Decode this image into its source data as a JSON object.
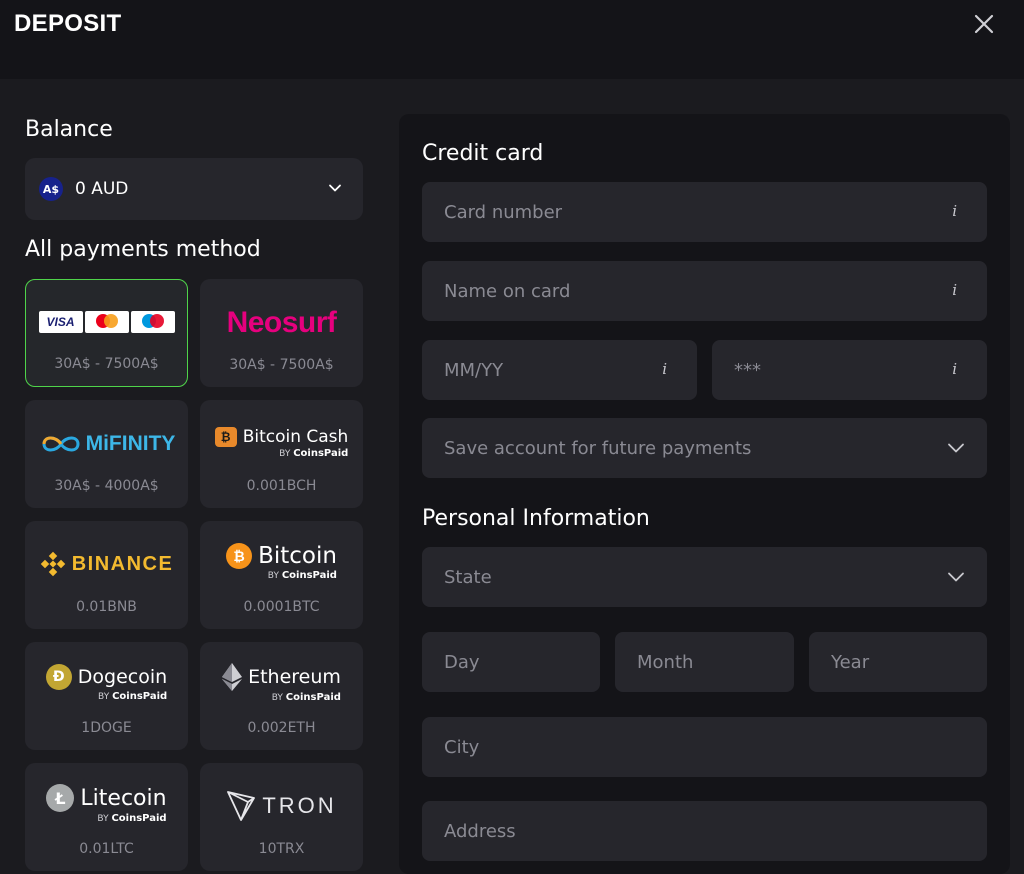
{
  "header": {
    "title": "DEPOSIT"
  },
  "balance": {
    "label": "Balance",
    "currency_badge": "A$",
    "value": "0 AUD"
  },
  "methods": {
    "label": "All payments method",
    "items": [
      {
        "name": "Visa / Mastercard / Maestro",
        "logo_text": "VISA",
        "limit": "30A$ - 7500A$",
        "selected": true
      },
      {
        "name": "Neosurf",
        "logo_text": "Neosurf",
        "limit": "30A$ - 7500A$"
      },
      {
        "name": "MiFinity",
        "logo_text": "MiFINITY",
        "limit": "30A$ - 4000A$"
      },
      {
        "name": "Bitcoin Cash",
        "logo_text": "Bitcoin Cash",
        "limit": "0.001BCH"
      },
      {
        "name": "Binance",
        "logo_text": "BINANCE",
        "limit": "0.01BNB"
      },
      {
        "name": "Bitcoin",
        "logo_text": "Bitcoin",
        "limit": "0.0001BTC"
      },
      {
        "name": "Dogecoin",
        "logo_text": "Dogecoin",
        "limit": "1DOGE"
      },
      {
        "name": "Ethereum",
        "logo_text": "Ethereum",
        "limit": "0.002ETH"
      },
      {
        "name": "Litecoin",
        "logo_text": "Litecoin",
        "limit": "0.01LTC"
      },
      {
        "name": "Tron",
        "logo_text": "TRON",
        "limit": "10TRX"
      }
    ],
    "provider_by": "BY",
    "provider_name": "CoinsPaid"
  },
  "credit_card": {
    "heading": "Credit card",
    "card_number_placeholder": "Card number",
    "name_placeholder": "Name on card",
    "expiry_placeholder": "MM/YY",
    "cvv_placeholder": "***",
    "save_account_label": "Save account for future payments",
    "info_glyph": "i"
  },
  "personal": {
    "heading": "Personal Information",
    "state_label": "State",
    "day_placeholder": "Day",
    "month_placeholder": "Month",
    "year_placeholder": "Year",
    "city_placeholder": "City",
    "address_placeholder": "Address"
  },
  "colors": {
    "background": "#1b1b1f",
    "panel": "#141418",
    "field": "#26262c",
    "selected_border": "#4fd44a",
    "muted_text": "#8a8a93"
  }
}
